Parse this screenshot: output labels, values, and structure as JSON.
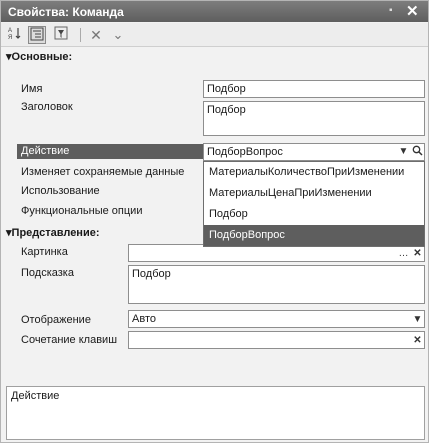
{
  "window": {
    "title": "Свойства: Команда",
    "pin_icon": "pin-icon",
    "close_icon": "close-icon"
  },
  "toolbar": {
    "icons": [
      "sort-alphabetical-icon",
      "categorized-view-icon",
      "filter-icon",
      "delete-icon",
      "check-icon"
    ]
  },
  "sections": {
    "main": {
      "title": "Основные:"
    },
    "view": {
      "title": "Представление:"
    }
  },
  "properties": {
    "name": {
      "label": "Имя",
      "value": "Подбор"
    },
    "caption": {
      "label": "Заголовок",
      "value": "Подбор"
    },
    "action": {
      "label": "Действие",
      "value": "ПодборВопрос"
    },
    "modifies_data": {
      "label": "Изменяет сохраняемые данные"
    },
    "usage": {
      "label": "Использование"
    },
    "functional_options": {
      "label": "Функциональные опции"
    },
    "picture": {
      "label": "Картинка",
      "value": ""
    },
    "tooltip": {
      "label": "Подсказка",
      "value": "Подбор"
    },
    "representation": {
      "label": "Отображение",
      "value": "Авто"
    },
    "shortcut": {
      "label": "Сочетание клавиш",
      "value": ""
    }
  },
  "action_dropdown": {
    "options": [
      "МатериалыКоличествоПриИзменении",
      "МатериалыЦенаПриИзменении",
      "Подбор",
      "ПодборВопрос"
    ],
    "selected": "ПодборВопрос"
  },
  "description": {
    "text": "Действие"
  },
  "colors": {
    "selection": "#5e5e5e",
    "titlebar": "#6b6b6b",
    "panel": "#f2f2f2"
  }
}
